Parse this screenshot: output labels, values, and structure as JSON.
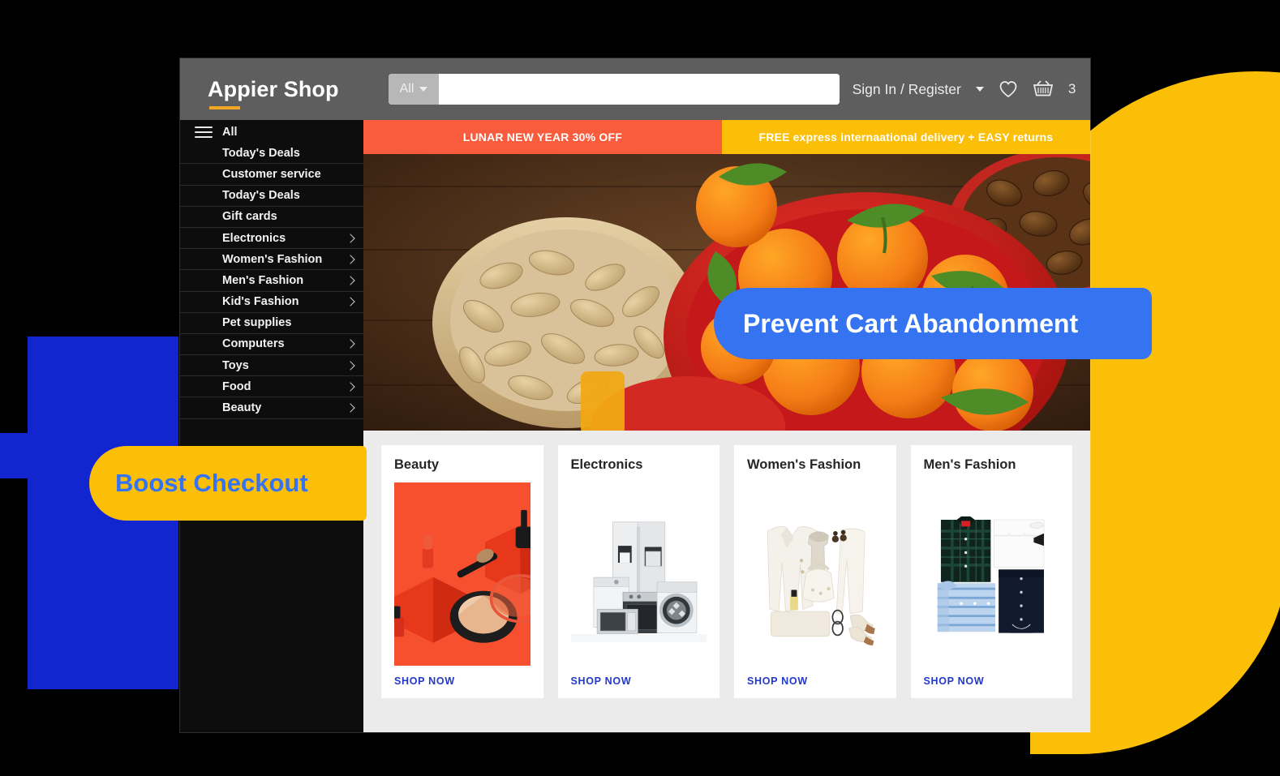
{
  "header": {
    "brand": "Appier Shop",
    "search": {
      "category": "All",
      "value": "",
      "placeholder": ""
    },
    "account_label": "Sign In / Register",
    "wishlist_icon": "heart-icon",
    "cart_icon": "basket-icon",
    "cart_count": "3"
  },
  "sidebar": {
    "menu_icon": "hamburger-icon",
    "items": [
      {
        "label": "All",
        "chevron": false
      },
      {
        "label": "Today's Deals",
        "chevron": false
      },
      {
        "label": "Customer service",
        "chevron": false
      },
      {
        "label": "Today's Deals",
        "chevron": false
      },
      {
        "label": "Gift cards",
        "chevron": false
      },
      {
        "label": "Electronics",
        "chevron": true
      },
      {
        "label": "Women's Fashion",
        "chevron": true
      },
      {
        "label": "Men's Fashion",
        "chevron": true
      },
      {
        "label": "Kid's Fashion",
        "chevron": true
      },
      {
        "label": "Pet supplies",
        "chevron": false
      },
      {
        "label": "Computers",
        "chevron": true
      },
      {
        "label": "Toys",
        "chevron": true
      },
      {
        "label": "Food",
        "chevron": true
      },
      {
        "label": "Beauty",
        "chevron": true
      }
    ]
  },
  "promos": [
    {
      "text": "LUNAR NEW YEAR 30% OFF",
      "color": "#f85c3c"
    },
    {
      "text": "FREE express internaational delivery + EASY returns",
      "color": "#fcbf07"
    }
  ],
  "hero": {
    "alt": "peanuts, oranges and nuts in bowls on a wooden table"
  },
  "cards": [
    {
      "title": "Beauty",
      "cta": "SHOP NOW",
      "image": "beauty-cosmetics-red"
    },
    {
      "title": "Electronics",
      "cta": "SHOP NOW",
      "image": "home-appliances"
    },
    {
      "title": "Women's Fashion",
      "cta": "SHOP NOW",
      "image": "womens-outfit-flatlay"
    },
    {
      "title": "Men's Fashion",
      "cta": "SHOP NOW",
      "image": "mens-shirts-flatlay"
    }
  ],
  "callouts": [
    {
      "text": "Prevent Cart Abandonment",
      "bg": "#3573f0",
      "fg": "#ffffff"
    },
    {
      "text": "Boost Checkout",
      "bg": "#fcbf07",
      "fg": "#3573f0"
    }
  ],
  "decor": {
    "cross_color": "#1226cf",
    "circle_color": "#fcbf07",
    "page_bg": "#000000"
  }
}
